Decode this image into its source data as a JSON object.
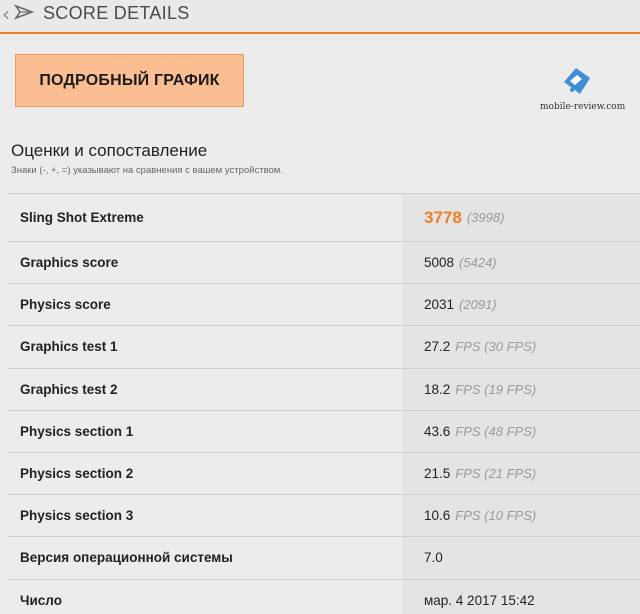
{
  "header": {
    "title": "SCORE DETAILS"
  },
  "button": {
    "label": "ПОДРОБНЫЙ ГРАФИК"
  },
  "brand": {
    "text": "mobile-review.com"
  },
  "section": {
    "title": "Оценки и сопоставление",
    "subtitle": "Знаки (-, +, =) указывают на сравнения с вашем устройством."
  },
  "rows": [
    {
      "label": "Sling Shot Extreme",
      "value": "3778",
      "compare": "(3998)"
    },
    {
      "label": "Graphics score",
      "value": "5008",
      "compare": "(5424)"
    },
    {
      "label": "Physics score",
      "value": "2031",
      "compare": "(2091)"
    },
    {
      "label": "Graphics test 1",
      "value": "27.2",
      "compare": "FPS (30 FPS)"
    },
    {
      "label": "Graphics test 2",
      "value": "18.2",
      "compare": "FPS (19 FPS)"
    },
    {
      "label": "Physics section 1",
      "value": "43.6",
      "compare": "FPS (48 FPS)"
    },
    {
      "label": "Physics section 2",
      "value": "21.5",
      "compare": "FPS (21 FPS)"
    },
    {
      "label": "Physics section 3",
      "value": "10.6",
      "compare": "FPS (10 FPS)"
    },
    {
      "label": "Версия операционной системы",
      "value": "7.0",
      "compare": ""
    },
    {
      "label": "Число",
      "value": "мар. 4 2017 15:42",
      "compare": ""
    }
  ],
  "colors": {
    "accent": "#f07e28",
    "button_bg": "#fbbd92",
    "value_cell_bg": "#e4e4e4"
  },
  "icons": {
    "back": "chevron-left-icon",
    "app": "3dmark-logo-icon",
    "brand": "mobile-review-logo-icon"
  }
}
